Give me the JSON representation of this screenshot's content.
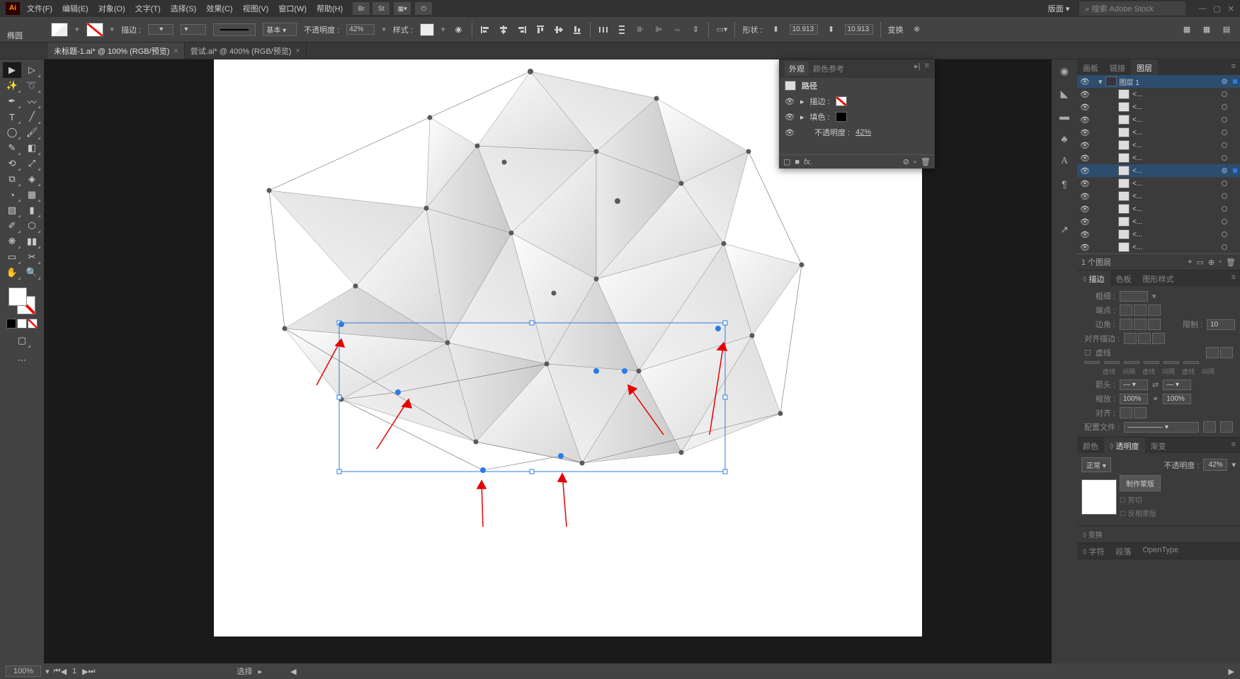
{
  "app": {
    "logo": "Ai"
  },
  "menu": [
    "文件(F)",
    "编辑(E)",
    "对象(O)",
    "文字(T)",
    "选择(S)",
    "效果(C)",
    "视图(V)",
    "窗口(W)",
    "帮助(H)"
  ],
  "titlebar_icons": [
    "Br",
    "St"
  ],
  "workspace": {
    "label": "版面",
    "search_placeholder": "搜索 Adobe Stock"
  },
  "tool_label": "椭圆",
  "control": {
    "stroke_label": "描边 :",
    "brush_label": "基本",
    "opacity_label": "不透明度 :",
    "opacity_val": "42%",
    "style_label": "样式 :",
    "shape_label": "形状 :",
    "w_val": "10.913 px",
    "h_val": "10.913 px",
    "transform_label": "变换"
  },
  "tabs": [
    {
      "label": "未标题-1.ai* @ 100% (RGB/预览)",
      "active": true
    },
    {
      "label": "尝试.ai* @ 400% (RGB/预览)",
      "active": false
    }
  ],
  "appearance": {
    "tab1": "外观",
    "tab2": "颜色参考",
    "title": "路径",
    "stroke": "描边 :",
    "fill": "填色 :",
    "opacity": "不透明度 :",
    "opacity_val": "42%",
    "fx": "fx."
  },
  "layers_panel": {
    "tabs": [
      "画板",
      "链接",
      "图层"
    ],
    "top_layer": "图层 1",
    "sublayers": [
      "<...",
      "<...",
      "<...",
      "<...",
      "<...",
      "<...",
      "<...",
      "<...",
      "<...",
      "<...",
      "<...",
      "<...",
      "<..."
    ],
    "count": "1 个图层"
  },
  "stroke_panel": {
    "tabs": [
      "描边",
      "色板",
      "图形样式"
    ],
    "weight": "粗细 :",
    "caps": "端点 :",
    "corner": "边角 :",
    "limit": "限制 :",
    "align": "对齐描边 :",
    "dashed": "虚线",
    "dash_lbl": [
      "虚线",
      "间隔",
      "虚线",
      "间隔",
      "虚线",
      "间隔"
    ],
    "arrow": "箭头 :",
    "scale": "缩放 :",
    "scale_val": "100%",
    "align_arrow": "对齐 :",
    "profile": "配置文件 :"
  },
  "color_panel": {
    "tabs": [
      "颜色",
      "透明度",
      "渐变"
    ],
    "mode": "正常",
    "opacity_label": "不透明度 :",
    "opacity_val": "42%",
    "make_mask": "制作蒙版",
    "clip": "剪切",
    "invert": "反相蒙版"
  },
  "transform_panel": {
    "label": "变换"
  },
  "char_panel": {
    "tabs": [
      "字符",
      "段落",
      "OpenType"
    ]
  },
  "status": {
    "zoom": "100%",
    "page": "1",
    "selection": "选择"
  }
}
